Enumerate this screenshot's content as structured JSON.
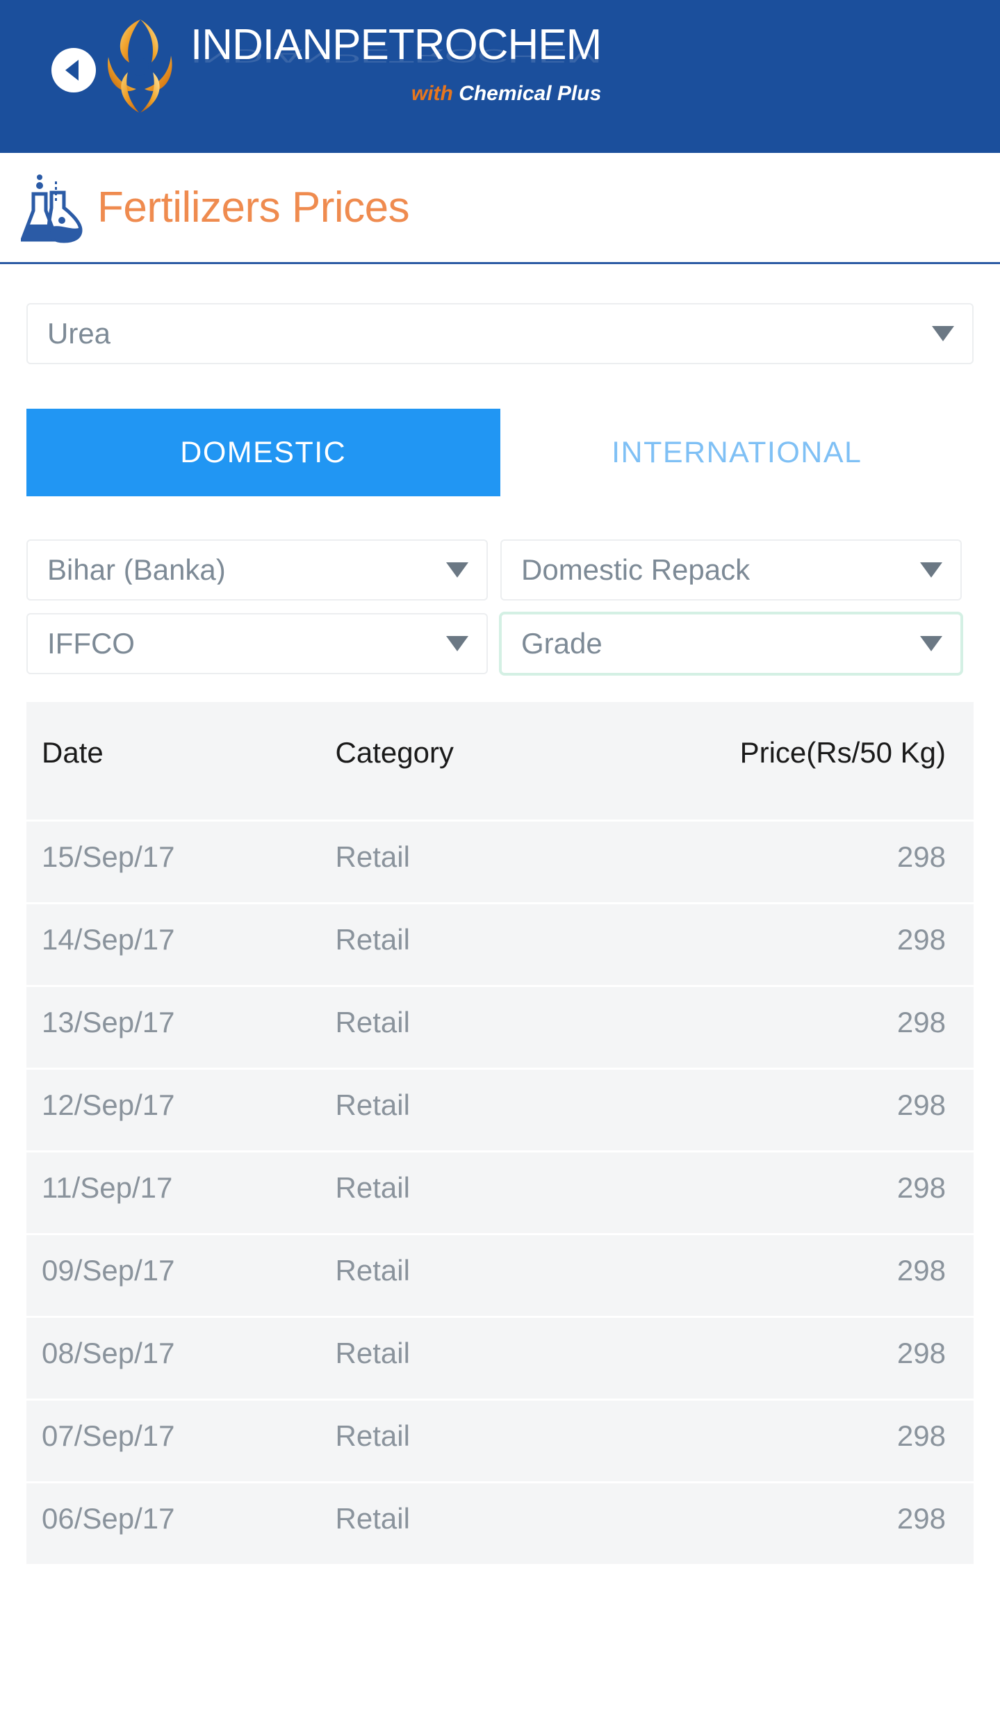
{
  "header": {
    "back_icon": "back-arrow-icon",
    "brand_name": "INDIANPETROCHEM",
    "tagline_prefix": "with",
    "tagline_main": "Chemical Plus",
    "bar_color": "#1b4f9c",
    "logo_icon": "petrochem-swirl-logo-icon"
  },
  "page": {
    "title": "Fertilizers Prices",
    "title_color": "#ef8b4f",
    "title_icon": "lab-flask-icon"
  },
  "product_select": {
    "value": "Urea",
    "caret_icon": "chevron-down-icon"
  },
  "tabs": [
    {
      "label": "DOMESTIC",
      "active": true
    },
    {
      "label": "INTERNATIONAL",
      "active": false
    }
  ],
  "tab_active_color": "#2196f3",
  "tab_inactive_color": "#7fc0f5",
  "filters": [
    {
      "name": "state-select",
      "value": "Bihar (Banka)",
      "focused": false
    },
    {
      "name": "packaging-select",
      "value": "Domestic Repack",
      "focused": false
    },
    {
      "name": "brand-select",
      "value": "IFFCO",
      "focused": false
    },
    {
      "name": "grade-select",
      "value": "Grade",
      "focused": true
    }
  ],
  "focus_border_color": "#d4f0e4",
  "table": {
    "columns": [
      "Date",
      "Category",
      "Price(Rs/50 Kg)"
    ],
    "rows": [
      {
        "date": "15/Sep/17",
        "category": "Retail",
        "price": "298"
      },
      {
        "date": "14/Sep/17",
        "category": "Retail",
        "price": "298"
      },
      {
        "date": "13/Sep/17",
        "category": "Retail",
        "price": "298"
      },
      {
        "date": "12/Sep/17",
        "category": "Retail",
        "price": "298"
      },
      {
        "date": "11/Sep/17",
        "category": "Retail",
        "price": "298"
      },
      {
        "date": "09/Sep/17",
        "category": "Retail",
        "price": "298"
      },
      {
        "date": "08/Sep/17",
        "category": "Retail",
        "price": "298"
      },
      {
        "date": "07/Sep/17",
        "category": "Retail",
        "price": "298"
      },
      {
        "date": "06/Sep/17",
        "category": "Retail",
        "price": "298"
      }
    ]
  }
}
